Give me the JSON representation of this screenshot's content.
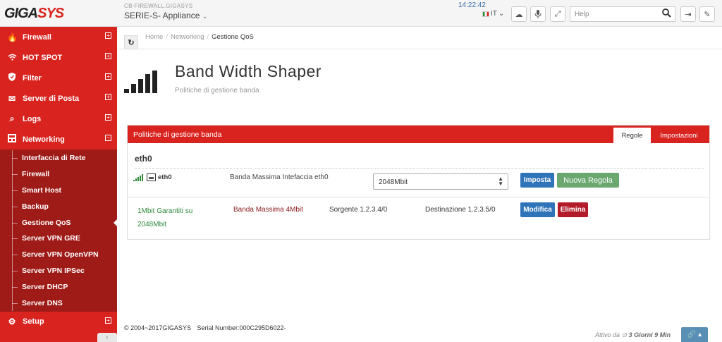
{
  "topbar": {
    "logo_main": "GIGASYS",
    "appliance_sub": "CB-FIREWALL.GIGASYS",
    "appliance_name": "SERIE-S- Appliance",
    "clock": "14:22:42",
    "lang": "IT",
    "help_placeholder": "Help"
  },
  "sidebar": {
    "items": [
      {
        "label": "Firewall",
        "icon": "flame-icon"
      },
      {
        "label": "HOT SPOT",
        "icon": "wifi-icon"
      },
      {
        "label": "Filter",
        "icon": "shield-icon"
      },
      {
        "label": "Server di Posta",
        "icon": "envelope-icon"
      },
      {
        "label": "Logs",
        "icon": "search-list-icon"
      },
      {
        "label": "Networking",
        "icon": "network-icon"
      }
    ],
    "networking_sub": [
      "Interfaccia di Rete",
      "Firewall",
      "Smart Host",
      "Backup",
      "Gestione QoS",
      "Server VPN GRE",
      "Server VPN OpenVPN",
      "Server VPN IPSec",
      "Server DHCP",
      "Server DNS"
    ],
    "active_sub": "Gestione QoS",
    "setup": {
      "label": "Setup",
      "icon": "gear-icon"
    }
  },
  "breadcrumb": {
    "home": "Home",
    "section": "Networking",
    "current": "Gestione QoS"
  },
  "header": {
    "title": "Band Width Shaper",
    "subtitle": "Politiche di gestione banda"
  },
  "panel": {
    "title": "Politiche di gestione banda",
    "tabs": {
      "regole": "Regole",
      "impostazioni": "Impostazioni"
    },
    "interface_title": "eth0",
    "interface_name": "eth0",
    "band_label": "Banda Massima Intefaccia eth0",
    "band_value": "2048Mbit",
    "btn_imposta": "Imposta",
    "btn_nuova": "Nuova Regola",
    "rule": {
      "guaranteed": "1Mbit Garantiti su 2048Mbit",
      "max": "Banda Massima 4Mbit",
      "source": "Sorgente 1.2.3.4/0",
      "dest": "Destinazione 1.2.3.5/0",
      "btn_modifica": "Modifica",
      "btn_elimina": "Elimina"
    }
  },
  "footer": {
    "copyright": "© 2004~2017GIGASYS",
    "serial": "Serial Number:000C295D6022-",
    "uptime_prefix": "Attivo da",
    "uptime_value": "3 Giorni 9 Min"
  },
  "colors": {
    "brand_red": "#d9231f",
    "sub_menu_dark": "#9e1b18",
    "primary_blue": "#2f74b8",
    "success_green": "#6aa870",
    "danger_red": "#b31a2a"
  }
}
